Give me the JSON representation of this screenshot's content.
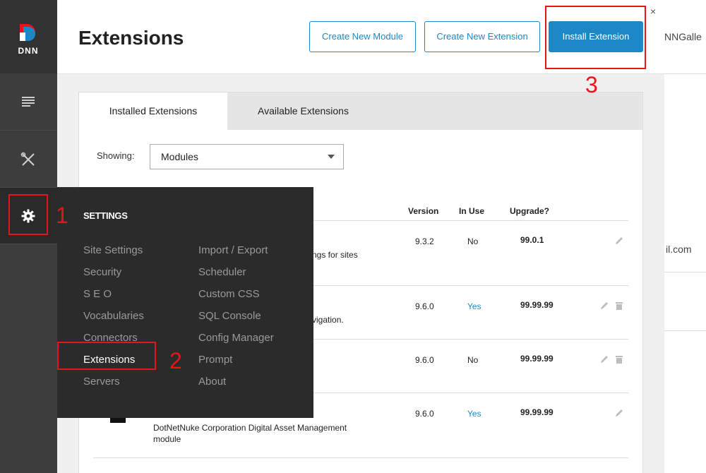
{
  "app": {
    "logo_text": "DNN"
  },
  "background_page": {
    "text_top": "NNGalle",
    "text_mid": "il.com"
  },
  "modal": {
    "title": "Extensions",
    "buttons": {
      "create_module": "Create New Module",
      "create_extension": "Create New Extension",
      "install_extension": "Install Extension"
    },
    "close": "×"
  },
  "tabs": [
    {
      "label": "Installed Extensions",
      "active": true
    },
    {
      "label": "Available Extensions",
      "active": false
    }
  ],
  "filter": {
    "label": "Showing:",
    "value": "Modules"
  },
  "table": {
    "headers": {
      "version": "Version",
      "in_use": "In Use",
      "upgrade": "Upgrade?"
    },
    "rows": [
      {
        "title": "",
        "desc": "ngs for sites",
        "version": "9.3.2",
        "in_use": "No",
        "upgrade": "99.0.1"
      },
      {
        "title": "",
        "desc": "vigation.",
        "version": "9.6.0",
        "in_use": "Yes",
        "upgrade": "99.99.99"
      },
      {
        "title": "",
        "desc": "",
        "version": "9.6.0",
        "in_use": "No",
        "upgrade": "99.99.99"
      },
      {
        "title": "",
        "desc_line1": "DotNetNuke Corporation Digital Asset Management",
        "desc_line2": "module",
        "version": "9.6.0",
        "in_use": "Yes",
        "upgrade": "99.99.99"
      }
    ]
  },
  "settings_menu": {
    "title": "SETTINGS",
    "col1": [
      "Site Settings",
      "Security",
      "S E O",
      "Vocabularies",
      "Connectors",
      "Extensions",
      "Servers"
    ],
    "col2": [
      "Import / Export",
      "Scheduler",
      "Custom CSS",
      "SQL Console",
      "Config Manager",
      "Prompt",
      "About"
    ]
  },
  "annotations": {
    "step1": "1",
    "step2": "2",
    "step3": "3"
  },
  "colors": {
    "accent": "#1e88c7",
    "annotation": "#e8141c",
    "rail": "#3d3d3d",
    "flyout": "#2b2b2b"
  }
}
